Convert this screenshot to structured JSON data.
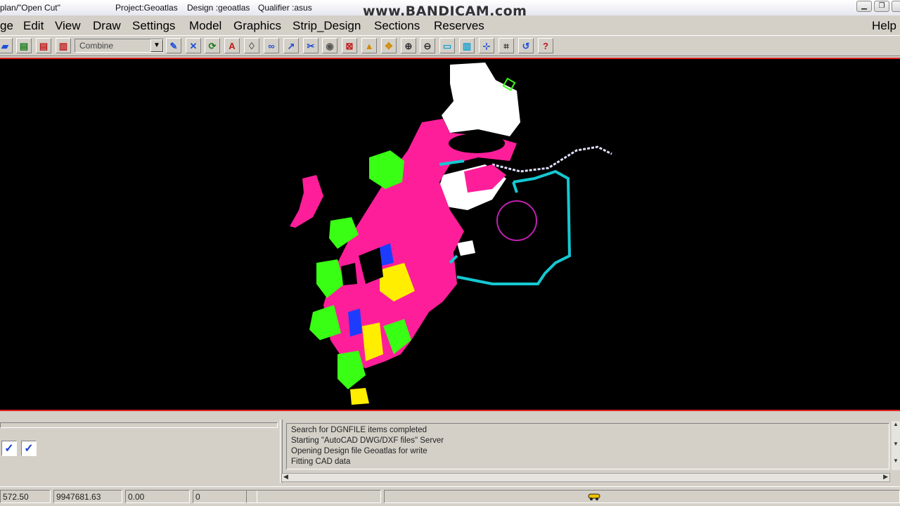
{
  "titlebar": {
    "left_text": "plan/\"Open Cut\"",
    "project": "Project:Geoatlas",
    "design": "Design :geoatlas",
    "qualifier": "Qualifier :asus",
    "watermark": "www.BANDICAM.com"
  },
  "menu": {
    "items": [
      "ge",
      "Edit",
      "View",
      "Draw",
      "Settings",
      "Model",
      "Graphics",
      "Strip_Design",
      "Sections",
      "Reserves"
    ],
    "help": "Help"
  },
  "toolbar": {
    "combo_value": "Combine",
    "icons_left": [
      "open-folder-icon",
      "printer-icon",
      "save-icon",
      "layers-icon"
    ],
    "icons_right": [
      "pencil-icon",
      "delete-x-icon",
      "refresh-icon",
      "font-icon",
      "bulb-icon",
      "binoculars-icon",
      "pointer-edit-icon",
      "eye-icon",
      "close-window-icon",
      "move-up-icon",
      "pan-icon",
      "zoom-in-icon",
      "zoom-out-icon",
      "window-icon",
      "columns-icon",
      "measure-icon",
      "grid-icon",
      "undo-icon",
      "help-icon"
    ]
  },
  "messages": [
    "Search for DGNFILE items completed",
    "Starting \"AutoCAD DWG/DXF files\" Server",
    "Opening Design file Geoatlas for write",
    "Fitting CAD data"
  ],
  "status": {
    "x_coord": "572.50",
    "y_coord": "9947681.63",
    "z_coord": "0.00",
    "count": "0",
    "field5": "",
    "field6": ""
  },
  "colors": {
    "canvas_bg": "#000000",
    "canvas_border": "#e02020",
    "map_white": "#ffffff",
    "map_magenta": "#ff1e9a",
    "map_green": "#39ff14",
    "map_cyan": "#14c8d2",
    "map_yellow": "#ffee00",
    "map_blue": "#1e3cff"
  }
}
